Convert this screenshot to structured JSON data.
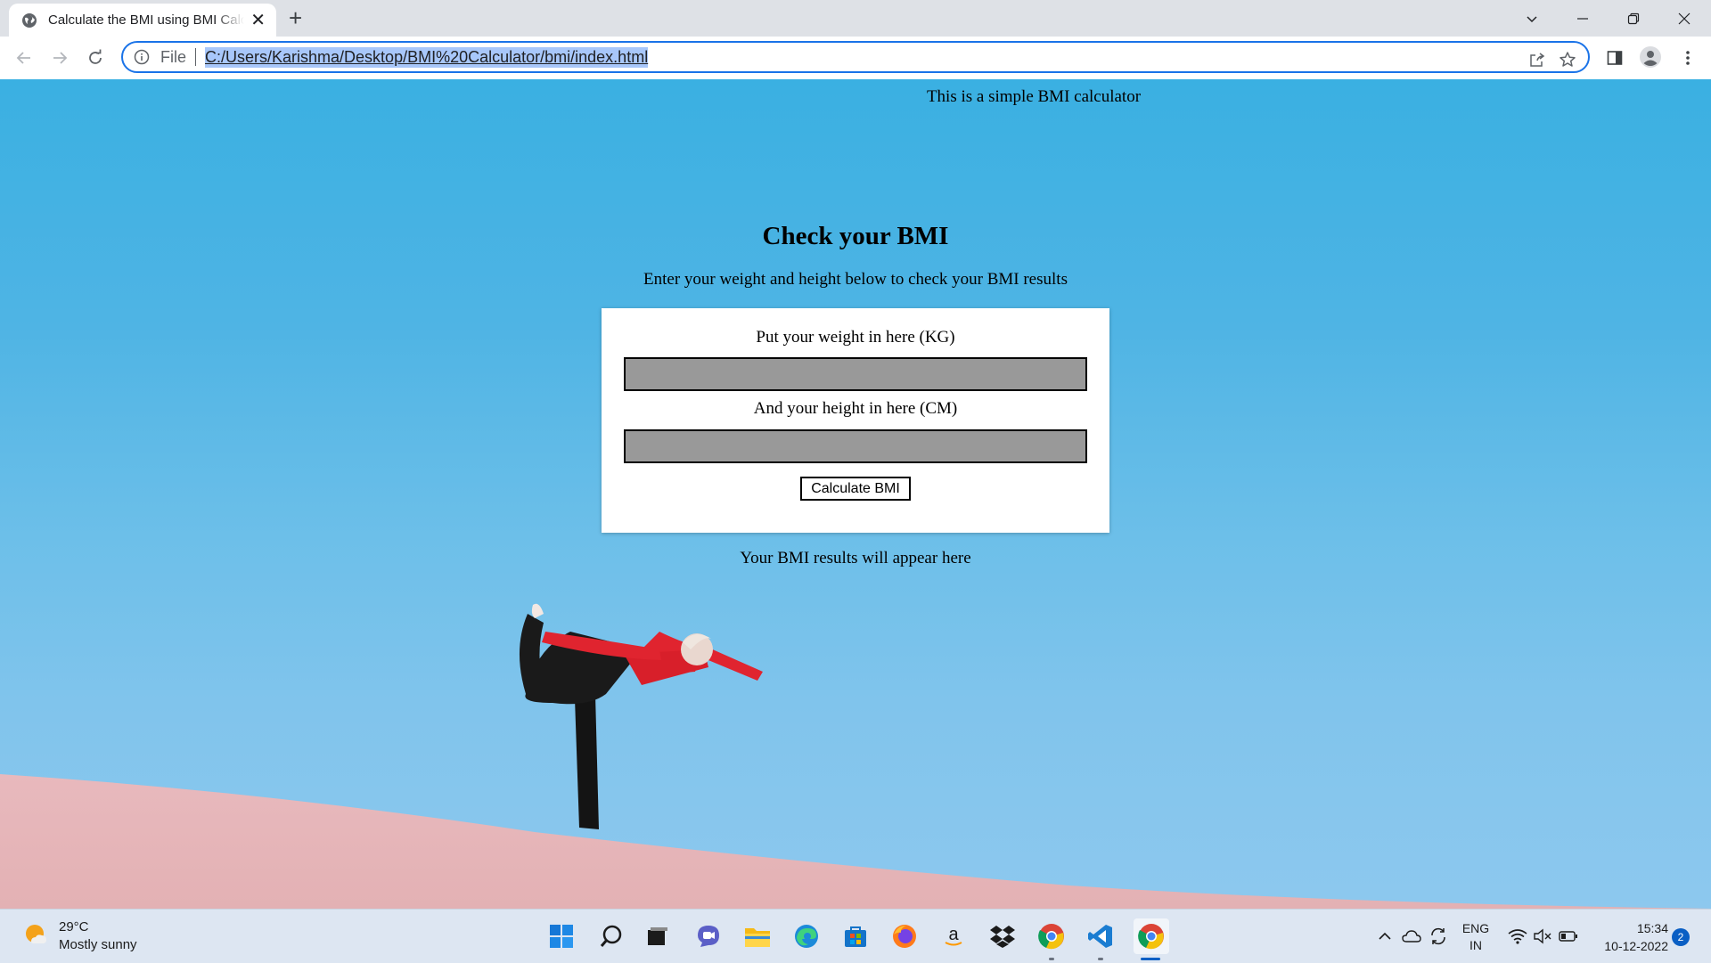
{
  "browser": {
    "tab": {
      "title": "Calculate the BMI using BMI Calculator",
      "favicon": "globe-icon",
      "close": "✕"
    },
    "new_tab": "+",
    "address": {
      "scheme_label": "File",
      "url": "C:/Users/Karishma/Desktop/BMI%20Calculator/bmi/index.html"
    }
  },
  "page": {
    "intro": "This is a simple BMI calculator",
    "heading": "Check your BMI",
    "subheading": "Enter your weight and height below to check your BMI results",
    "form": {
      "weight_label": "Put your weight in here (KG)",
      "weight_value": "",
      "height_label": "And your height in here (CM)",
      "height_value": "",
      "button_label": "Calculate BMI"
    },
    "result": "Your BMI results will appear here"
  },
  "taskbar": {
    "weather": {
      "temp": "29°C",
      "condition": "Mostly sunny"
    },
    "apps": [
      "windows-start-icon",
      "search-icon",
      "task-view-icon",
      "teams-chat-icon",
      "file-explorer-icon",
      "edge-icon",
      "microsoft-store-icon",
      "firefox-icon",
      "amazon-icon",
      "dropbox-icon",
      "chrome-icon",
      "vscode-icon",
      "chrome-active-icon"
    ],
    "lang_top": "ENG",
    "lang_bottom": "IN",
    "time": "15:34",
    "date": "10-12-2022",
    "notification_count": "2"
  },
  "colors": {
    "accent": "#1a73e8",
    "sky": "#4fb4e4",
    "input_bg": "#999999"
  }
}
